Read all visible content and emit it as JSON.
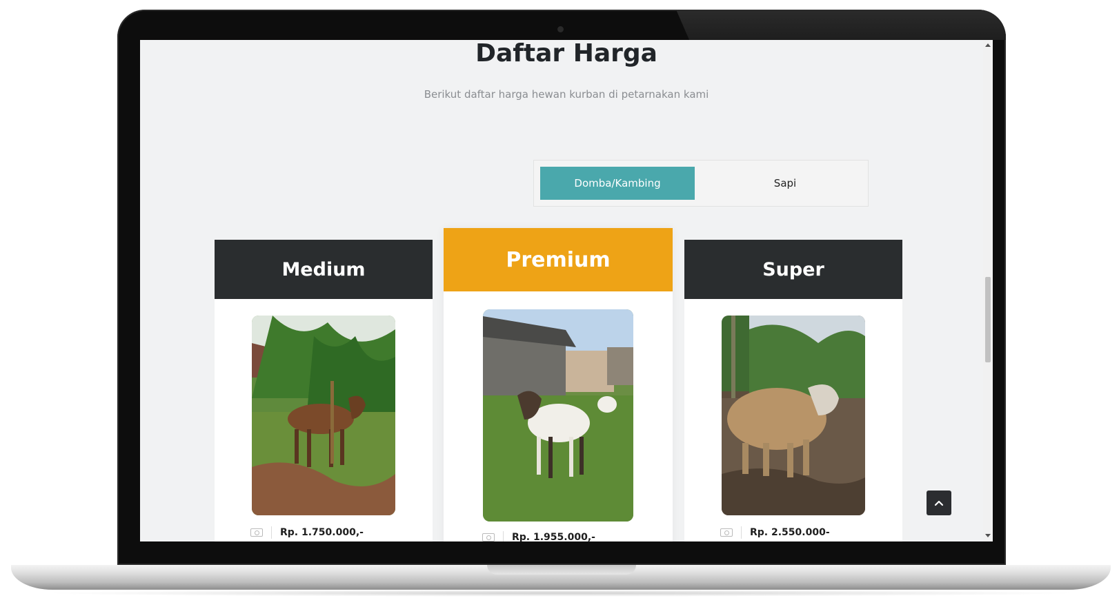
{
  "section": {
    "title": "Daftar Harga",
    "subtitle": "Berikut daftar harga hewan kurban di petarnakan kami"
  },
  "tabs": [
    {
      "label": "Domba/Kambing",
      "active": true
    },
    {
      "label": "Sapi",
      "active": false
    }
  ],
  "pricing": [
    {
      "tier": "Medium",
      "price": "Rp. 1.750.000,-",
      "header_color": "#2a2d2f",
      "image": "brown-goat-photo"
    },
    {
      "tier": "Premium",
      "price": "Rp. 1.955.000,-",
      "header_color": "#eea316",
      "image": "white-goat-photo"
    },
    {
      "tier": "Super",
      "price": "Rp. 2.550.000-",
      "header_color": "#2a2d2f",
      "image": "woolly-sheep-photo"
    }
  ],
  "colors": {
    "accent_tab": "#4aa8ac",
    "premium": "#eea316",
    "dark_header": "#2a2d2f",
    "page_bg": "#f1f2f3"
  },
  "icons": {
    "price": "money-icon",
    "back_to_top": "chevron-up-icon"
  }
}
